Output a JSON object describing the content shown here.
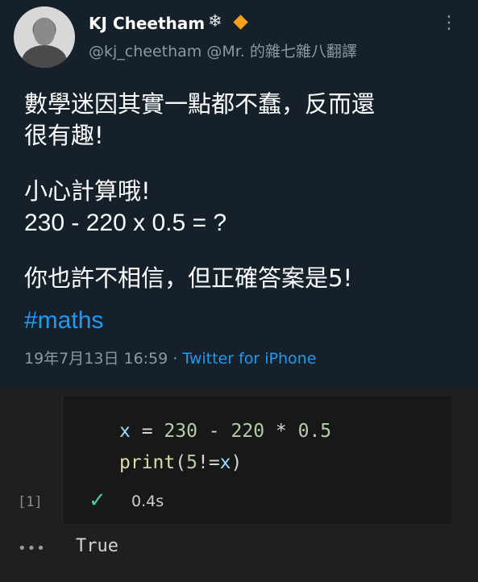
{
  "tweet": {
    "display_name": "KJ Cheetham",
    "badge_snow": "❄",
    "handle": "@kj_cheetham @Mr. 的雜七雜八翻譯",
    "more_icon": "⋮",
    "lines": [
      "數學迷因其實一點都不蠢，反而還",
      "很有趣!",
      "小心計算哦!",
      "230 - 220 x 0.5 = ?",
      "你也許不相信，但正確答案是5!"
    ],
    "hashtag": "#maths",
    "timestamp": "19年7月13日 16:59",
    "separator": " · ",
    "app": "Twitter for iPhone",
    "colors": {
      "link": "#1d9bf0",
      "diamond": "#f7a01d",
      "background": "#15202b"
    }
  },
  "notebook": {
    "code_line1": {
      "var": "x",
      "eq": " = ",
      "n1": "230",
      "minus": " - ",
      "n2": "220",
      "times": " * ",
      "n3": "0.5"
    },
    "code_line2": {
      "fn": "print",
      "open": "(",
      "n": "5",
      "op": "!=",
      "var": "x",
      "close": ")"
    },
    "exec_count": "[1]",
    "status_icon": "✓",
    "exec_time": "0.4s",
    "output_ellipsis": "•••",
    "output": "True"
  }
}
